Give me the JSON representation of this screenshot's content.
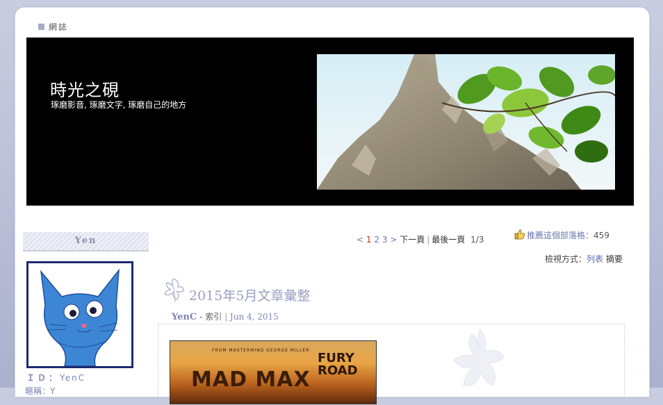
{
  "breadcrumb": {
    "label": "網誌"
  },
  "blog": {
    "title": "時光之硯",
    "subtitle": "琢磨影音, 琢磨文字, 琢磨自己的地方"
  },
  "sidebar": {
    "heading": "Yen",
    "id_label": "ＩＤ：",
    "id_value": "YenC",
    "cut_label": "暱稱：Y"
  },
  "pager": {
    "prev": "<",
    "pages": [
      "1",
      "2",
      "3"
    ],
    "current": "1",
    "next": ">",
    "next_page": "下一頁",
    "last_page": "最後一頁",
    "position": "1/3"
  },
  "recommend": {
    "label": "推薦這個部落格：",
    "count": "459"
  },
  "view_mode": {
    "label": "檢視方式：",
    "list": "列表",
    "summary": "摘要"
  },
  "post": {
    "title": "2015年5月文章彙整",
    "author": "YenC",
    "category": "索引",
    "date": "Jun 4, 2015",
    "image": {
      "credit": "FROM MASTERMIND GEORGE MILLER",
      "title": "MAD MAX",
      "subtitle": "FURY ROAD"
    }
  },
  "colors": {
    "accent": "#7d86b2",
    "banner": "#000000",
    "avatar_border": "#1e2a6e"
  }
}
